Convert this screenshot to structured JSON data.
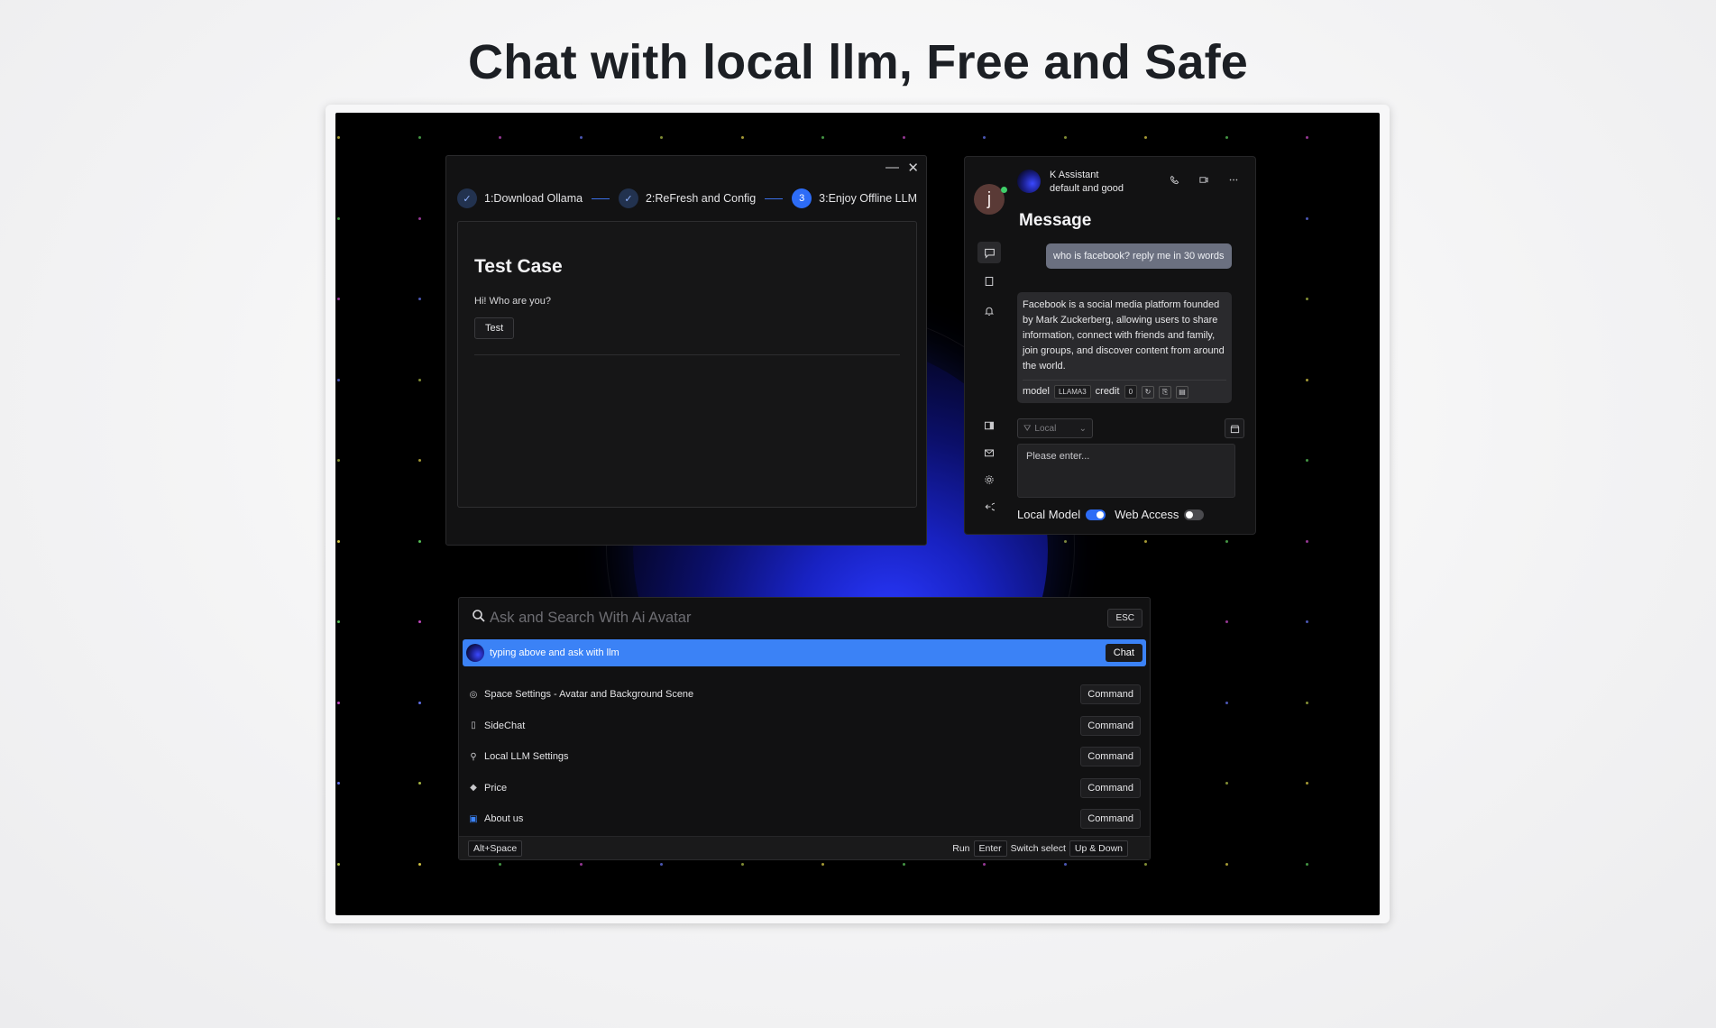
{
  "hero": {
    "title": "Chat with local llm, Free and Safe"
  },
  "onboarding": {
    "minimize_glyph": "—",
    "close_glyph": "✕",
    "steps": [
      {
        "marker": "✓",
        "label": "1:Download Ollama",
        "state": "done"
      },
      {
        "marker": "✓",
        "label": "2:ReFresh and Config",
        "state": "done"
      },
      {
        "marker": "3",
        "label": "3:Enjoy Offline LLM",
        "state": "active"
      }
    ],
    "test_case": {
      "title": "Test Case",
      "prompt": "Hi! Who are you?",
      "button": "Test"
    }
  },
  "chat": {
    "user_initial": "j",
    "assistant_name": "K Assistant",
    "assistant_status": "default and good",
    "section_title": "Message",
    "messages": [
      {
        "role": "user",
        "text": "who is facebook?  reply me in 30 words"
      },
      {
        "role": "assistant",
        "text": "Facebook is a social media platform founded by Mark Zuckerberg, allowing users to share information, connect with friends and family, join groups, and discover content from around the world."
      }
    ],
    "meta": {
      "model_label": "model",
      "model_value": "LLAMA3",
      "credit_label": "credit",
      "credit_value": "0"
    },
    "source_select": "Local",
    "input_placeholder": "Please enter...",
    "toggles": [
      {
        "label": "Local Model",
        "on": true
      },
      {
        "label": "Web Access",
        "on": false
      }
    ]
  },
  "palette": {
    "search_placeholder": "Ask and Search With Ai Avatar",
    "esc_label": "ESC",
    "chat_row": {
      "label": "typing above and ask with llm",
      "button": "Chat"
    },
    "commands": [
      {
        "icon": "target-icon",
        "glyph": "◎",
        "label": "Space Settings - Avatar and Background Scene",
        "badge": "Command"
      },
      {
        "icon": "sidebar-icon",
        "glyph": "▯",
        "label": "SideChat",
        "badge": "Command"
      },
      {
        "icon": "wrench-icon",
        "glyph": "⚲",
        "label": "Local LLM Settings",
        "badge": "Command"
      },
      {
        "icon": "tag-icon",
        "glyph": "◆",
        "label": "Price",
        "badge": "Command"
      },
      {
        "icon": "info-icon",
        "glyph": "▣",
        "label": "About us",
        "badge": "Command"
      }
    ],
    "footer": {
      "shortcut": "Alt+Space",
      "run_label": "Run",
      "run_key": "Enter",
      "switch_label": "Switch select",
      "switch_key": "Up & Down"
    }
  },
  "colors": {
    "accent": "#3b82f6",
    "step_active": "#2d6cf6",
    "stage_background": "#000000",
    "online": "#3fcf6a"
  }
}
